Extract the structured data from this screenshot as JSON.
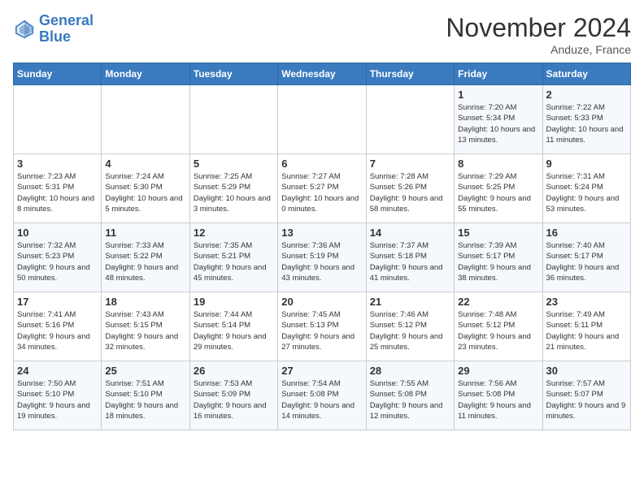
{
  "logo": {
    "text_general": "General",
    "text_blue": "Blue"
  },
  "title": "November 2024",
  "location": "Anduze, France",
  "header_days": [
    "Sunday",
    "Monday",
    "Tuesday",
    "Wednesday",
    "Thursday",
    "Friday",
    "Saturday"
  ],
  "weeks": [
    [
      {
        "day": "",
        "info": ""
      },
      {
        "day": "",
        "info": ""
      },
      {
        "day": "",
        "info": ""
      },
      {
        "day": "",
        "info": ""
      },
      {
        "day": "",
        "info": ""
      },
      {
        "day": "1",
        "info": "Sunrise: 7:20 AM\nSunset: 5:34 PM\nDaylight: 10 hours and 13 minutes."
      },
      {
        "day": "2",
        "info": "Sunrise: 7:22 AM\nSunset: 5:33 PM\nDaylight: 10 hours and 11 minutes."
      }
    ],
    [
      {
        "day": "3",
        "info": "Sunrise: 7:23 AM\nSunset: 5:31 PM\nDaylight: 10 hours and 8 minutes."
      },
      {
        "day": "4",
        "info": "Sunrise: 7:24 AM\nSunset: 5:30 PM\nDaylight: 10 hours and 5 minutes."
      },
      {
        "day": "5",
        "info": "Sunrise: 7:25 AM\nSunset: 5:29 PM\nDaylight: 10 hours and 3 minutes."
      },
      {
        "day": "6",
        "info": "Sunrise: 7:27 AM\nSunset: 5:27 PM\nDaylight: 10 hours and 0 minutes."
      },
      {
        "day": "7",
        "info": "Sunrise: 7:28 AM\nSunset: 5:26 PM\nDaylight: 9 hours and 58 minutes."
      },
      {
        "day": "8",
        "info": "Sunrise: 7:29 AM\nSunset: 5:25 PM\nDaylight: 9 hours and 55 minutes."
      },
      {
        "day": "9",
        "info": "Sunrise: 7:31 AM\nSunset: 5:24 PM\nDaylight: 9 hours and 53 minutes."
      }
    ],
    [
      {
        "day": "10",
        "info": "Sunrise: 7:32 AM\nSunset: 5:23 PM\nDaylight: 9 hours and 50 minutes."
      },
      {
        "day": "11",
        "info": "Sunrise: 7:33 AM\nSunset: 5:22 PM\nDaylight: 9 hours and 48 minutes."
      },
      {
        "day": "12",
        "info": "Sunrise: 7:35 AM\nSunset: 5:21 PM\nDaylight: 9 hours and 45 minutes."
      },
      {
        "day": "13",
        "info": "Sunrise: 7:36 AM\nSunset: 5:19 PM\nDaylight: 9 hours and 43 minutes."
      },
      {
        "day": "14",
        "info": "Sunrise: 7:37 AM\nSunset: 5:18 PM\nDaylight: 9 hours and 41 minutes."
      },
      {
        "day": "15",
        "info": "Sunrise: 7:39 AM\nSunset: 5:17 PM\nDaylight: 9 hours and 38 minutes."
      },
      {
        "day": "16",
        "info": "Sunrise: 7:40 AM\nSunset: 5:17 PM\nDaylight: 9 hours and 36 minutes."
      }
    ],
    [
      {
        "day": "17",
        "info": "Sunrise: 7:41 AM\nSunset: 5:16 PM\nDaylight: 9 hours and 34 minutes."
      },
      {
        "day": "18",
        "info": "Sunrise: 7:43 AM\nSunset: 5:15 PM\nDaylight: 9 hours and 32 minutes."
      },
      {
        "day": "19",
        "info": "Sunrise: 7:44 AM\nSunset: 5:14 PM\nDaylight: 9 hours and 29 minutes."
      },
      {
        "day": "20",
        "info": "Sunrise: 7:45 AM\nSunset: 5:13 PM\nDaylight: 9 hours and 27 minutes."
      },
      {
        "day": "21",
        "info": "Sunrise: 7:46 AM\nSunset: 5:12 PM\nDaylight: 9 hours and 25 minutes."
      },
      {
        "day": "22",
        "info": "Sunrise: 7:48 AM\nSunset: 5:12 PM\nDaylight: 9 hours and 23 minutes."
      },
      {
        "day": "23",
        "info": "Sunrise: 7:49 AM\nSunset: 5:11 PM\nDaylight: 9 hours and 21 minutes."
      }
    ],
    [
      {
        "day": "24",
        "info": "Sunrise: 7:50 AM\nSunset: 5:10 PM\nDaylight: 9 hours and 19 minutes."
      },
      {
        "day": "25",
        "info": "Sunrise: 7:51 AM\nSunset: 5:10 PM\nDaylight: 9 hours and 18 minutes."
      },
      {
        "day": "26",
        "info": "Sunrise: 7:53 AM\nSunset: 5:09 PM\nDaylight: 9 hours and 16 minutes."
      },
      {
        "day": "27",
        "info": "Sunrise: 7:54 AM\nSunset: 5:08 PM\nDaylight: 9 hours and 14 minutes."
      },
      {
        "day": "28",
        "info": "Sunrise: 7:55 AM\nSunset: 5:08 PM\nDaylight: 9 hours and 12 minutes."
      },
      {
        "day": "29",
        "info": "Sunrise: 7:56 AM\nSunset: 5:08 PM\nDaylight: 9 hours and 11 minutes."
      },
      {
        "day": "30",
        "info": "Sunrise: 7:57 AM\nSunset: 5:07 PM\nDaylight: 9 hours and 9 minutes."
      }
    ]
  ]
}
